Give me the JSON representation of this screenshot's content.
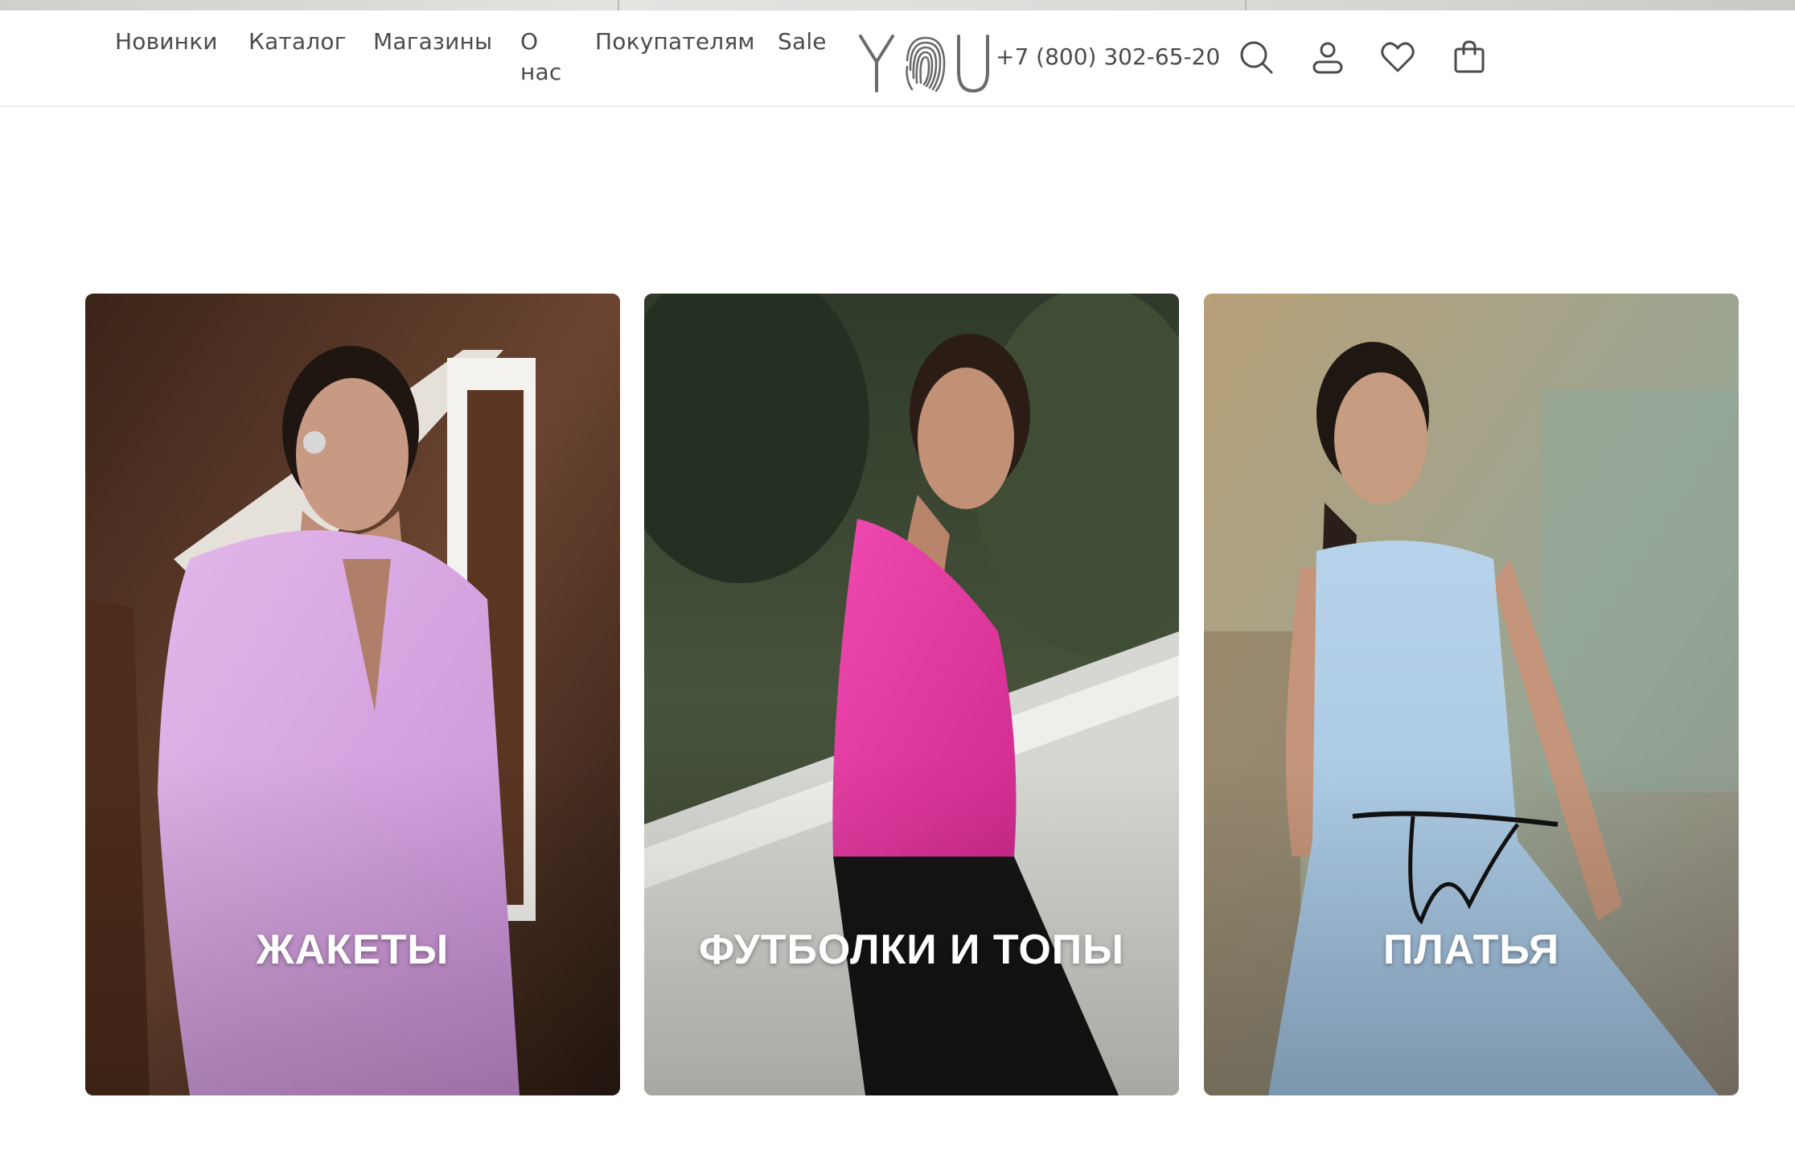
{
  "header": {
    "nav": [
      {
        "label": "Новинки"
      },
      {
        "label": "Каталог"
      },
      {
        "label": "Магазины"
      },
      {
        "label": "О нас"
      },
      {
        "label": "Покупателям"
      },
      {
        "label": "Sale"
      }
    ],
    "logo_text": "YOU",
    "phone": "+7 (800) 302-65-20",
    "icons": [
      "search-icon",
      "account-icon",
      "favorites-icon",
      "cart-icon"
    ]
  },
  "categories": [
    {
      "label": "ЖАКЕТЫ"
    },
    {
      "label": "ФУТБОЛКИ И ТОПЫ"
    },
    {
      "label": "ПЛАТЬЯ"
    }
  ],
  "colors": {
    "nav_text": "#4b4b4b",
    "card_label": "#ffffff",
    "header_border": "#ebebeb"
  }
}
